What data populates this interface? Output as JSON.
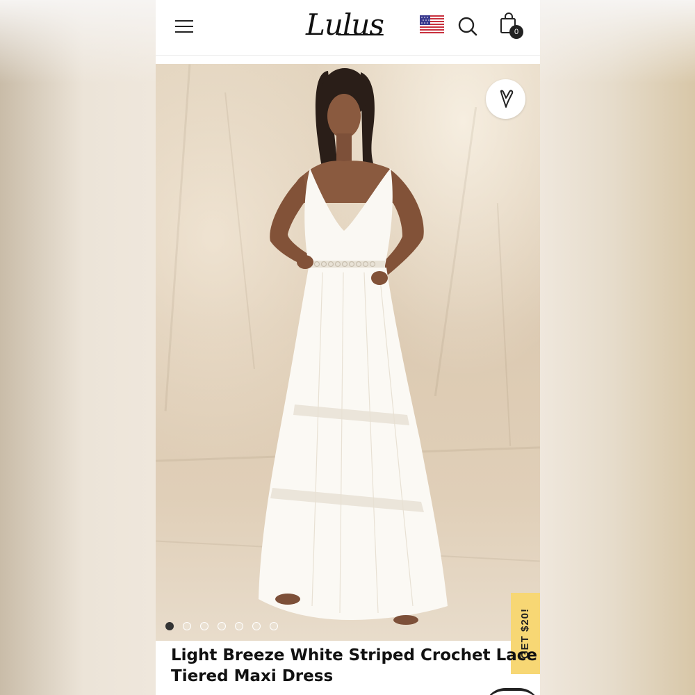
{
  "header": {
    "logo_text": "Lulus",
    "cart_count": "0",
    "icons": [
      "hamburger-menu-icon",
      "us-flag-icon",
      "search-icon",
      "shopping-bag-icon"
    ]
  },
  "gallery": {
    "image_count": 7,
    "active_index": 0,
    "wishlist_icon": "heart-icon"
  },
  "promo": {
    "label": "GET $20!",
    "color": "#f7d774"
  },
  "product": {
    "title_line1": "Light Breeze White Striped Crochet Lace",
    "title_line2": "Tiered Maxi Dress"
  }
}
